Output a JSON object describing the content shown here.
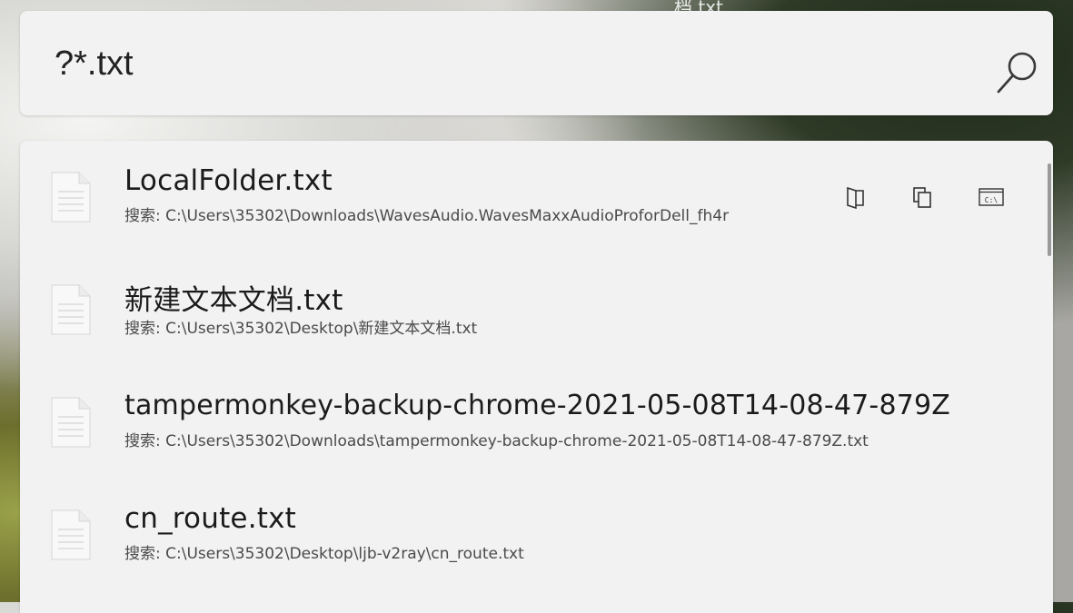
{
  "search": {
    "value": "?*.txt"
  },
  "background_text": "档.txt",
  "results": [
    {
      "name": "LocalFolder.txt",
      "path": "搜索: C:\\Users\\35302\\Downloads\\WavesAudio.WavesMaxxAudioProforDell_fh4r"
    },
    {
      "name": "新建文本文档.txt",
      "path": "搜索: C:\\Users\\35302\\Desktop\\新建文本文档.txt"
    },
    {
      "name": "tampermonkey-backup-chrome-2021-05-08T14-08-47-879Z",
      "path": "搜索: C:\\Users\\35302\\Downloads\\tampermonkey-backup-chrome-2021-05-08T14-08-47-879Z.txt"
    },
    {
      "name": "cn_route.txt",
      "path": "搜索: C:\\Users\\35302\\Desktop\\ljb-v2ray\\cn_route.txt"
    }
  ],
  "actions": {
    "open_folder_icon": "open-folder-icon",
    "copy_path_icon": "copy-icon",
    "terminal_label": "C:\\"
  }
}
